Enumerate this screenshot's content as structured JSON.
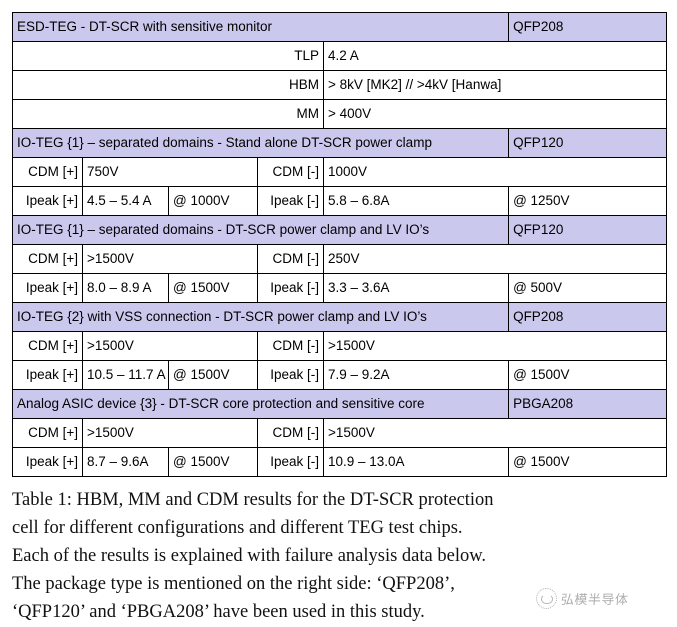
{
  "table": {
    "sections": [
      {
        "header": "ESD-TEG - DT-SCR with sensitive monitor",
        "package": "QFP208",
        "type": "esd",
        "rows": [
          {
            "label": "TLP",
            "value": "4.2 A"
          },
          {
            "label": "HBM",
            "value": "> 8kV [MK2] //  >4kV [Hanwa]"
          },
          {
            "label": "MM",
            "value": "> 400V"
          }
        ]
      },
      {
        "header": "IO-TEG {1} – separated domains - Stand alone DT-SCR power clamp",
        "package": "QFP120",
        "type": "io",
        "cdm": {
          "left_label": "CDM [+]",
          "left_value": "750V",
          "right_label": "CDM [-]",
          "right_value": "1000V"
        },
        "ipeak": {
          "left_label": "Ipeak [+]",
          "left_value": "4.5 – 5.4 A",
          "left_cond": "@ 1000V",
          "right_label": "Ipeak [-]",
          "right_value": "5.8 – 6.8A",
          "right_cond": "@ 1250V"
        }
      },
      {
        "header": "IO-TEG {1} – separated domains  - DT-SCR power clamp and LV IO’s",
        "package": "QFP120",
        "type": "io",
        "cdm": {
          "left_label": "CDM [+]",
          "left_value": ">1500V",
          "right_label": "CDM [-]",
          "right_value": "250V"
        },
        "ipeak": {
          "left_label": "Ipeak [+]",
          "left_value": "8.0 – 8.9 A",
          "left_cond": "@ 1500V",
          "right_label": "Ipeak [-]",
          "right_value": "3.3 – 3.6A",
          "right_cond": "@ 500V"
        }
      },
      {
        "header": "IO-TEG {2} with VSS connection - DT-SCR power clamp and LV IO’s",
        "package": "QFP208",
        "type": "io",
        "cdm": {
          "left_label": "CDM [+]",
          "left_value": ">1500V",
          "right_label": "CDM [-]",
          "right_value": ">1500V"
        },
        "ipeak": {
          "left_label": "Ipeak [+]",
          "left_value": "10.5 – 11.7 A",
          "left_cond": "@ 1500V",
          "right_label": "Ipeak [-]",
          "right_value": "7.9 – 9.2A",
          "right_cond": "@ 1500V"
        }
      },
      {
        "header": "Analog ASIC device {3} - DT-SCR core protection and sensitive core",
        "package": "PBGA208",
        "type": "io",
        "cdm": {
          "left_label": "CDM [+]",
          "left_value": ">1500V",
          "right_label": "CDM [-]",
          "right_value": ">1500V"
        },
        "ipeak": {
          "left_label": "Ipeak [+]",
          "left_value": "8.7 – 9.6A",
          "left_cond": "@ 1500V",
          "right_label": "Ipeak [-]",
          "right_value": "10.9 – 13.0A",
          "right_cond": "@ 1500V"
        }
      }
    ]
  },
  "caption": {
    "line1": "Table 1: HBM, MM and CDM results for the DT-SCR protection",
    "line2": "cell for different configurations and different TEG test chips.",
    "line3": "Each of the results is explained with failure analysis data below.",
    "line4": "The package type is mentioned on the right side: ‘QFP208’,",
    "line5": "‘QFP120’ and ‘PBGA208’ have been used in this study."
  },
  "watermark": {
    "text": "弘模半导体"
  },
  "colors": {
    "section_fill": "#cbc8ee",
    "section_border": "#3a3a5c",
    "grid": "#000000",
    "page_bg": "#ffffff"
  }
}
